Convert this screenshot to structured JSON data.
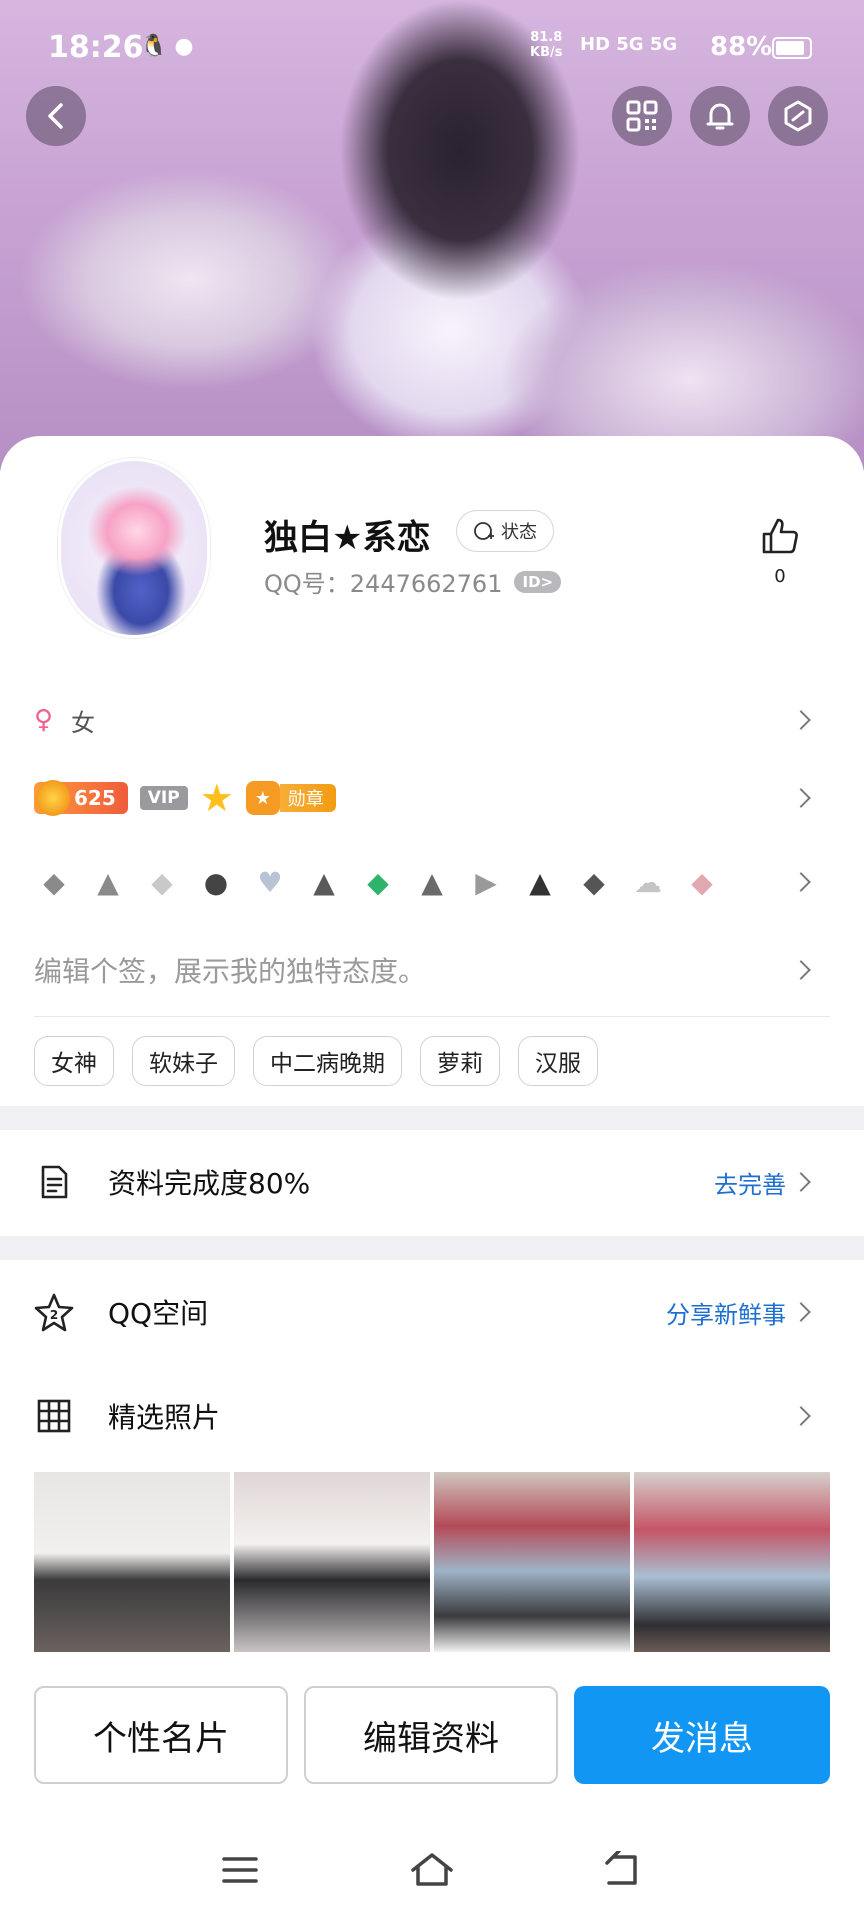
{
  "status_bar": {
    "time": "18:26",
    "network_speed": "81.8\nKB/s",
    "signal": "HD 5G 5G",
    "battery_percent": "88%",
    "battery_level": 0.88
  },
  "profile": {
    "name": "独白★系恋",
    "status_label": "状态",
    "qq_number": "QQ号：2447662761",
    "id_badge": "ID>",
    "likes": "0",
    "gender": "女",
    "level": "625",
    "vip_label": "VIP",
    "medal_label": "勋章",
    "signature_placeholder": "编辑个签，展示我的独特态度。",
    "tags": [
      "女神",
      "软妹子",
      "中二病晚期",
      "萝莉",
      "汉服"
    ]
  },
  "sections": {
    "completion_label": "资料完成度80%",
    "completion_action": "去完善",
    "qzone_label": "QQ空间",
    "qzone_action": "分享新鲜事",
    "photos_label": "精选照片"
  },
  "actions": {
    "card_button": "个性名片",
    "edit_button": "编辑资料",
    "message_button": "发消息"
  },
  "colors": {
    "accent_blue": "#1296f4",
    "link_blue": "#1e6fd0",
    "female_pink": "#f06292"
  }
}
